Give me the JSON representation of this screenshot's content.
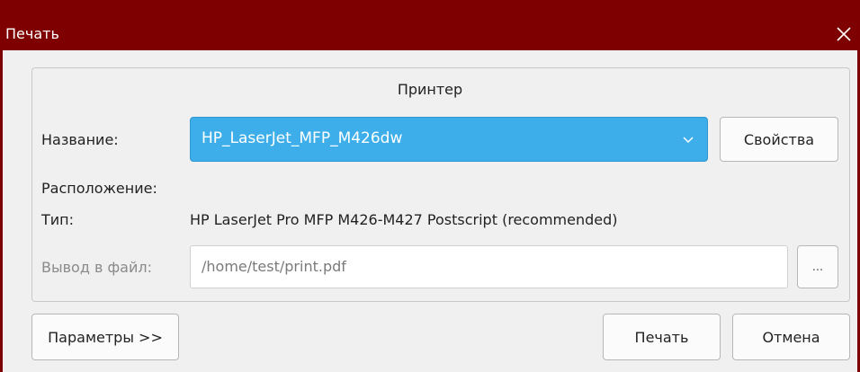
{
  "window": {
    "title": "Печать",
    "close_icon": "close-icon",
    "titlebar_color": "#7f0000"
  },
  "printer_group": {
    "title": "Принтер",
    "name_label": "Название:",
    "selected_printer": "HP_LaserJet_MFP_M426dw",
    "properties_button": "Свойства",
    "location_label": "Расположение:",
    "location_value": "",
    "type_label": "Тип:",
    "type_value": "HP LaserJet Pro MFP M426-M427 Postscript (recommended)",
    "output_label": "Вывод в файл:",
    "output_path": "/home/test/print.pdf",
    "browse_button": "...",
    "accent_color": "#3daee9"
  },
  "buttons": {
    "options": "Параметры >>",
    "print": "Печать",
    "cancel": "Отмена"
  }
}
